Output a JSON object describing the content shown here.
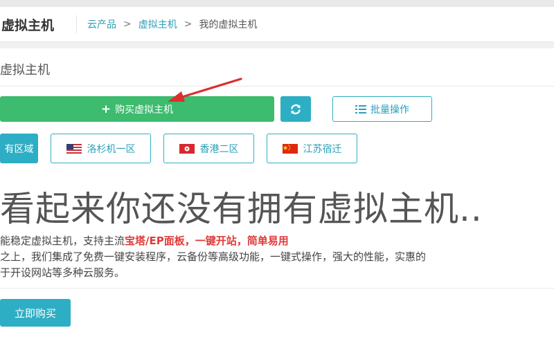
{
  "header": {
    "title": "虚拟主机",
    "breadcrumb": [
      "云产品",
      "虚拟主机",
      "我的虚拟主机"
    ],
    "separator": ">"
  },
  "panel": {
    "title": "虚拟主机"
  },
  "toolbar": {
    "buy_label": "购买虚拟主机",
    "batch_label": "批量操作"
  },
  "regions": [
    {
      "label": "有区域",
      "active": true
    },
    {
      "label": "洛杉机一区",
      "flag": "us"
    },
    {
      "label": "香港二区",
      "flag": "hk"
    },
    {
      "label": "江苏宿迁",
      "flag": "cn"
    }
  ],
  "empty_state": {
    "headline": "看起来你还没有拥有虚拟主机..",
    "line1_prefix": "能稳定虚拟主机，支持主流",
    "line1_highlight": "宝塔/EP面板，一键开站，简单易用",
    "line2": "之上，我们集成了免费一键安装程序，云备份等高级功能，一键式操作，强大的性能，实惠的",
    "line3": "于开设网站等多种云服务。",
    "buy_now_label": "立即购买"
  },
  "colors": {
    "primary_teal": "#2eaec4",
    "green": "#3dbb6e",
    "highlight_red": "#e03a3a",
    "arrow_red": "#d9302f"
  }
}
